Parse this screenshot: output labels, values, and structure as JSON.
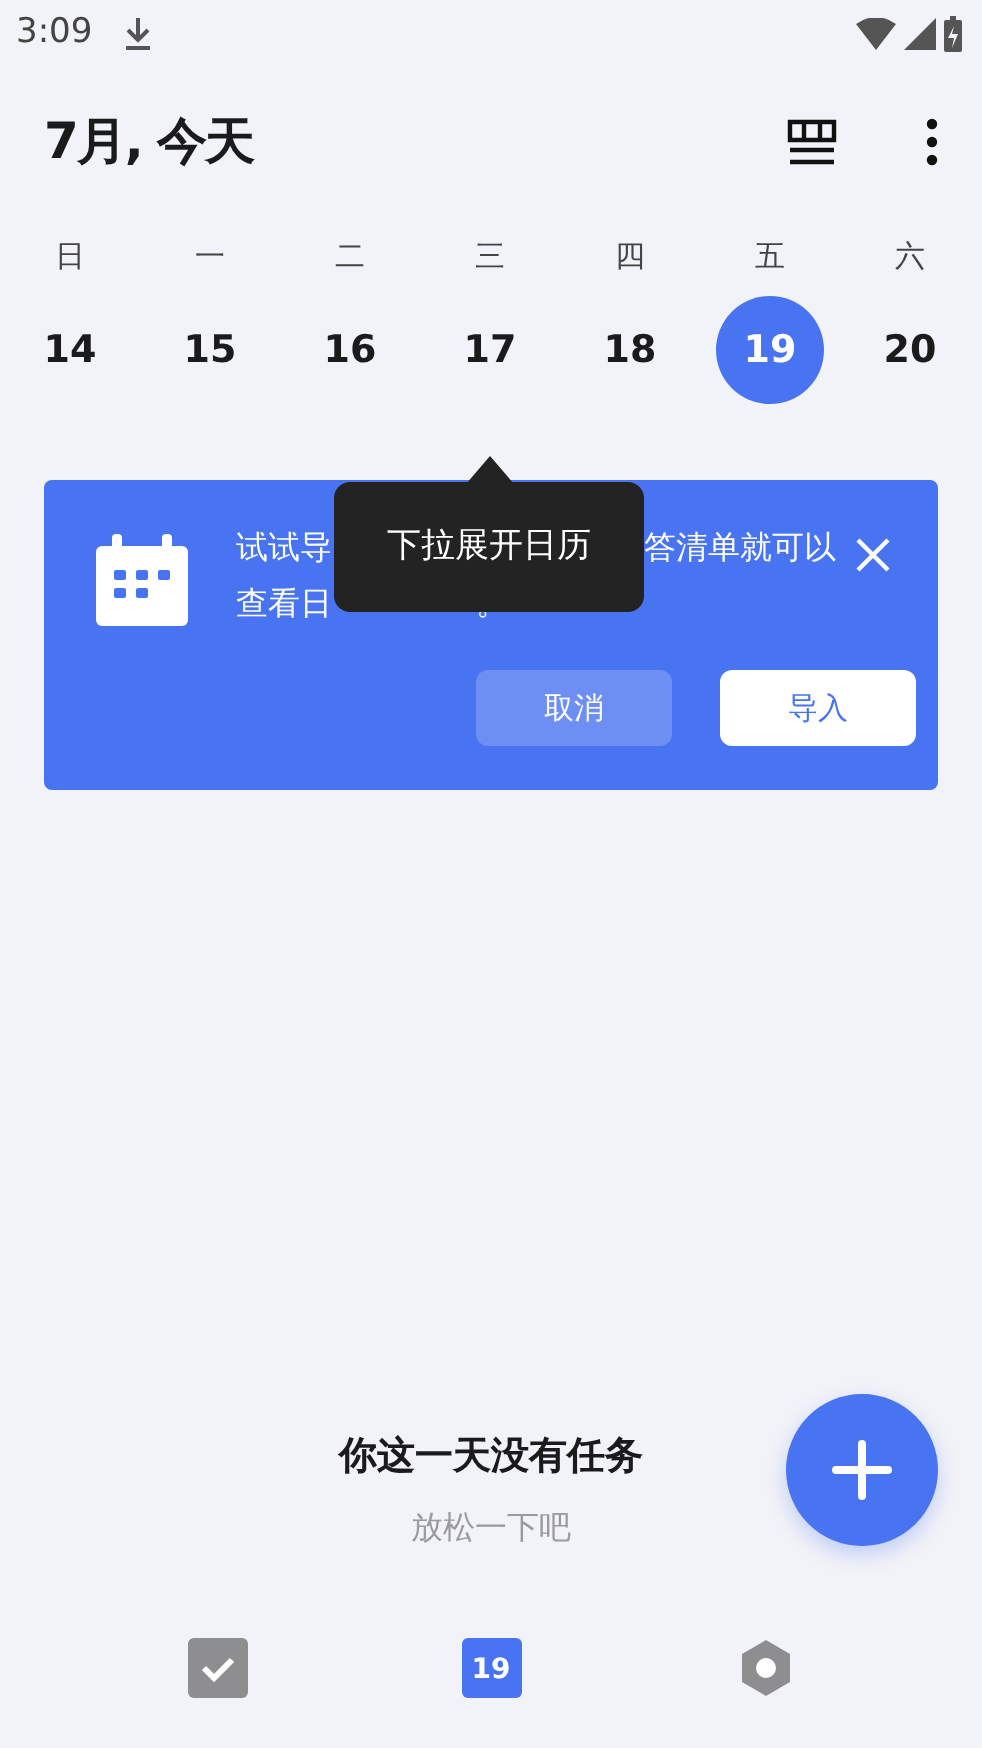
{
  "status_bar": {
    "time": "3:09"
  },
  "header": {
    "title": "7月, 今天"
  },
  "week": [
    {
      "weekday": "日",
      "day": "14",
      "selected": false
    },
    {
      "weekday": "一",
      "day": "15",
      "selected": false
    },
    {
      "weekday": "二",
      "day": "16",
      "selected": false
    },
    {
      "weekday": "三",
      "day": "17",
      "selected": false
    },
    {
      "weekday": "四",
      "day": "18",
      "selected": false
    },
    {
      "weekday": "五",
      "day": "19",
      "selected": true
    },
    {
      "weekday": "六",
      "day": "20",
      "selected": false
    }
  ],
  "banner": {
    "line_1": [
      "试试导",
      "答清单就可以"
    ],
    "line_2": [
      "查看日",
      "。"
    ],
    "buttons": [
      {
        "label": "取消",
        "kind": "secondary"
      },
      {
        "label": "导入",
        "kind": "primary"
      }
    ]
  },
  "tooltip": {
    "text": "下拉展开日历"
  },
  "empty_state": {
    "title": "你这一天没有任务",
    "subtitle": "放松一下吧"
  },
  "bottom_nav": [
    {
      "kind": "tasks",
      "selected": false
    },
    {
      "kind": "calendar",
      "label": "19",
      "selected": true
    },
    {
      "kind": "settings",
      "selected": false
    }
  ]
}
